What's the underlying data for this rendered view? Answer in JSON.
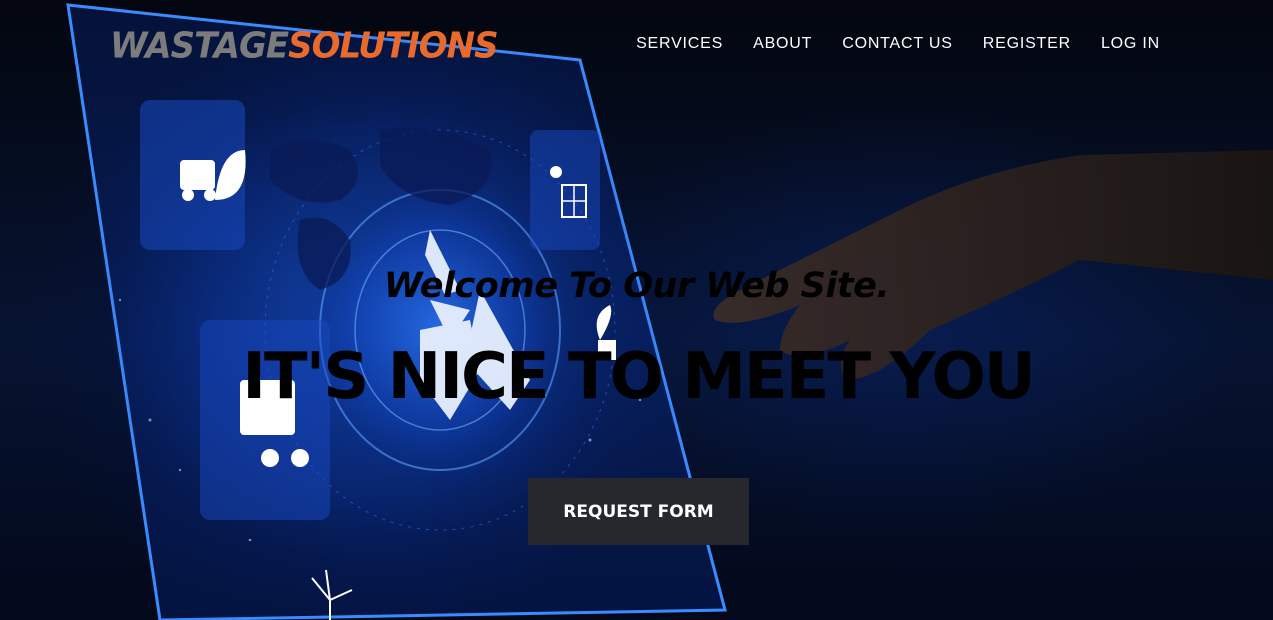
{
  "brand": {
    "part1": "WASTAGE",
    "part2": "SOLUTIONS"
  },
  "nav": {
    "items": [
      {
        "label": "SERVICES"
      },
      {
        "label": "ABOUT"
      },
      {
        "label": "CONTACT US"
      },
      {
        "label": "REGISTER"
      },
      {
        "label": "LOG IN"
      }
    ]
  },
  "masthead": {
    "subheading": "Welcome To Our Web Site.",
    "heading": "IT'S NICE TO MEET YOU",
    "cta_label": "REQUEST FORM"
  },
  "colors": {
    "brand_gray": "#7c7c7c",
    "brand_orange": "#e86a2c",
    "cta_bg": "#26282d",
    "background": "#02050d"
  },
  "icons": [
    "recycle-icon",
    "truck-leaf-icon",
    "solar-panel-icon",
    "wind-turbine-icon",
    "plant-icon",
    "world-map",
    "hand-pointing"
  ]
}
